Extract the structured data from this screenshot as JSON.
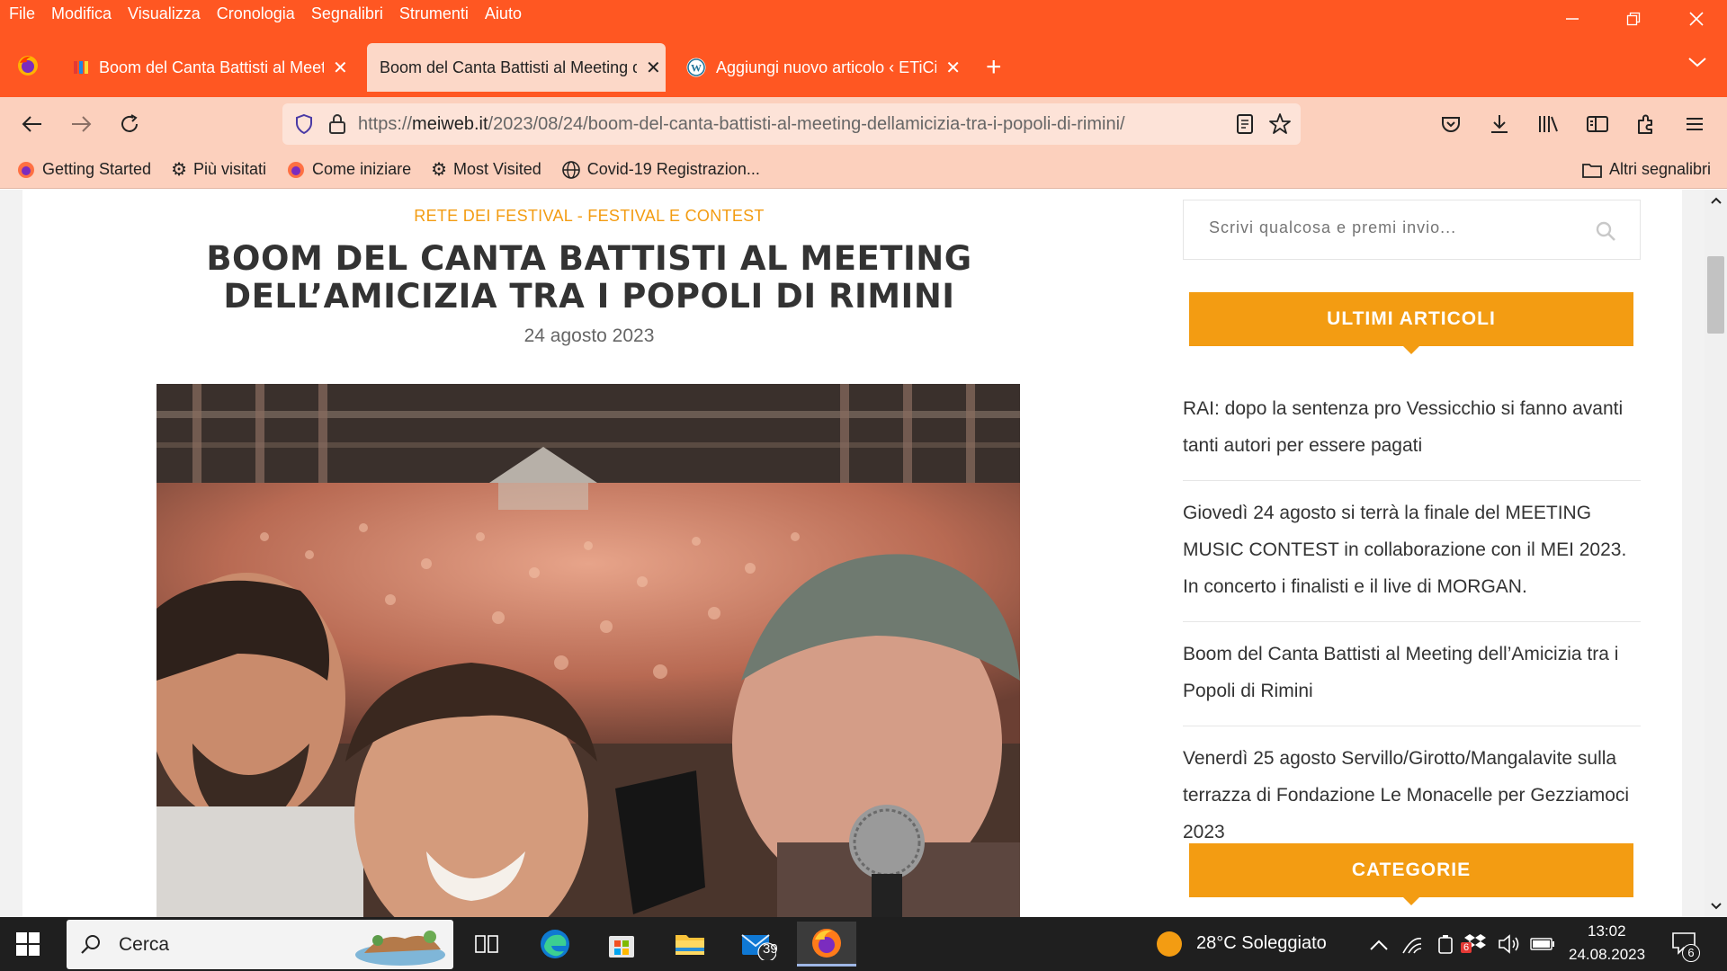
{
  "menubar": {
    "items": [
      "File",
      "Modifica",
      "Visualizza",
      "Cronologia",
      "Segnalibri",
      "Strumenti",
      "Aiuto"
    ]
  },
  "tabs": [
    {
      "title": "Boom del Canta Battisti al Meeting dell’Amicizia",
      "active": false
    },
    {
      "title": "Boom del Canta Battisti al Meeting dell’Amicizia",
      "active": true
    },
    {
      "title": "Aggiungi nuovo articolo ‹ ETiCinema",
      "active": false
    }
  ],
  "url": {
    "prefix": "https://",
    "domain": "meiweb.it",
    "path": "/2023/08/24/boom-del-canta-battisti-al-meeting-dellamicizia-tra-i-popoli-di-rimini/"
  },
  "bookmarks": {
    "items": [
      "Getting Started",
      "Più visitati",
      "Come iniziare",
      "Most Visited",
      "Covid-19 Registrazion..."
    ],
    "other": "Altri segnalibri"
  },
  "post": {
    "category": "RETE DEI FESTIVAL - FESTIVAL E CONTEST",
    "title": "BOOM DEL CANTA BATTISTI AL MEETING DELL’AMICIZIA TRA I POPOLI DI RIMINI",
    "date": "24 agosto 2023"
  },
  "sidebar": {
    "search_placeholder": "Scrivi qualcosa e premi invio...",
    "latest_title": "ULTIMI ARTICOLI",
    "articles": [
      "RAI: dopo la sentenza pro Vessicchio si fanno avanti tanti autori per essere pagati",
      "Giovedì 24 agosto si terrà la finale del MEETING MUSIC CONTEST in collaborazione con il MEI 2023. In concerto i finalisti e il live di MORGAN.",
      "Boom del Canta Battisti al Meeting dell’Amicizia tra i Popoli di Rimini",
      "Venerdì 25 agosto Servillo/Girotto/Mangalavite sulla terrazza di Fondazione Le Monacelle per Gezziamoci 2023"
    ],
    "categories_title": "CATEGORIE"
  },
  "taskbar": {
    "search": "Cerca",
    "mail_badge": "39",
    "weather": "28°C  Soleggiato",
    "time": "13:02",
    "date": "24.08.2023",
    "notif_badge": "6",
    "tray_badge": "6"
  },
  "colors": {
    "chrome": "#ff5722",
    "navbar": "#fcd0bd",
    "accent": "#f39c12"
  }
}
